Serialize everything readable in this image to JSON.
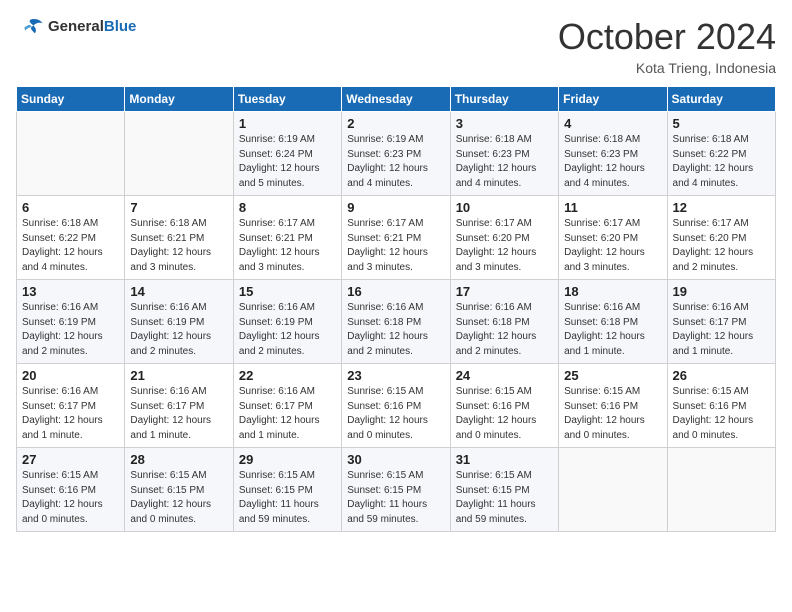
{
  "header": {
    "logo_general": "General",
    "logo_blue": "Blue",
    "title": "October 2024",
    "location": "Kota Trieng, Indonesia"
  },
  "weekdays": [
    "Sunday",
    "Monday",
    "Tuesday",
    "Wednesday",
    "Thursday",
    "Friday",
    "Saturday"
  ],
  "weeks": [
    [
      {
        "day": "",
        "info": ""
      },
      {
        "day": "",
        "info": ""
      },
      {
        "day": "1",
        "info": "Sunrise: 6:19 AM\nSunset: 6:24 PM\nDaylight: 12 hours and 5 minutes."
      },
      {
        "day": "2",
        "info": "Sunrise: 6:19 AM\nSunset: 6:23 PM\nDaylight: 12 hours and 4 minutes."
      },
      {
        "day": "3",
        "info": "Sunrise: 6:18 AM\nSunset: 6:23 PM\nDaylight: 12 hours and 4 minutes."
      },
      {
        "day": "4",
        "info": "Sunrise: 6:18 AM\nSunset: 6:23 PM\nDaylight: 12 hours and 4 minutes."
      },
      {
        "day": "5",
        "info": "Sunrise: 6:18 AM\nSunset: 6:22 PM\nDaylight: 12 hours and 4 minutes."
      }
    ],
    [
      {
        "day": "6",
        "info": "Sunrise: 6:18 AM\nSunset: 6:22 PM\nDaylight: 12 hours and 4 minutes."
      },
      {
        "day": "7",
        "info": "Sunrise: 6:18 AM\nSunset: 6:21 PM\nDaylight: 12 hours and 3 minutes."
      },
      {
        "day": "8",
        "info": "Sunrise: 6:17 AM\nSunset: 6:21 PM\nDaylight: 12 hours and 3 minutes."
      },
      {
        "day": "9",
        "info": "Sunrise: 6:17 AM\nSunset: 6:21 PM\nDaylight: 12 hours and 3 minutes."
      },
      {
        "day": "10",
        "info": "Sunrise: 6:17 AM\nSunset: 6:20 PM\nDaylight: 12 hours and 3 minutes."
      },
      {
        "day": "11",
        "info": "Sunrise: 6:17 AM\nSunset: 6:20 PM\nDaylight: 12 hours and 3 minutes."
      },
      {
        "day": "12",
        "info": "Sunrise: 6:17 AM\nSunset: 6:20 PM\nDaylight: 12 hours and 2 minutes."
      }
    ],
    [
      {
        "day": "13",
        "info": "Sunrise: 6:16 AM\nSunset: 6:19 PM\nDaylight: 12 hours and 2 minutes."
      },
      {
        "day": "14",
        "info": "Sunrise: 6:16 AM\nSunset: 6:19 PM\nDaylight: 12 hours and 2 minutes."
      },
      {
        "day": "15",
        "info": "Sunrise: 6:16 AM\nSunset: 6:19 PM\nDaylight: 12 hours and 2 minutes."
      },
      {
        "day": "16",
        "info": "Sunrise: 6:16 AM\nSunset: 6:18 PM\nDaylight: 12 hours and 2 minutes."
      },
      {
        "day": "17",
        "info": "Sunrise: 6:16 AM\nSunset: 6:18 PM\nDaylight: 12 hours and 2 minutes."
      },
      {
        "day": "18",
        "info": "Sunrise: 6:16 AM\nSunset: 6:18 PM\nDaylight: 12 hours and 1 minute."
      },
      {
        "day": "19",
        "info": "Sunrise: 6:16 AM\nSunset: 6:17 PM\nDaylight: 12 hours and 1 minute."
      }
    ],
    [
      {
        "day": "20",
        "info": "Sunrise: 6:16 AM\nSunset: 6:17 PM\nDaylight: 12 hours and 1 minute."
      },
      {
        "day": "21",
        "info": "Sunrise: 6:16 AM\nSunset: 6:17 PM\nDaylight: 12 hours and 1 minute."
      },
      {
        "day": "22",
        "info": "Sunrise: 6:16 AM\nSunset: 6:17 PM\nDaylight: 12 hours and 1 minute."
      },
      {
        "day": "23",
        "info": "Sunrise: 6:15 AM\nSunset: 6:16 PM\nDaylight: 12 hours and 0 minutes."
      },
      {
        "day": "24",
        "info": "Sunrise: 6:15 AM\nSunset: 6:16 PM\nDaylight: 12 hours and 0 minutes."
      },
      {
        "day": "25",
        "info": "Sunrise: 6:15 AM\nSunset: 6:16 PM\nDaylight: 12 hours and 0 minutes."
      },
      {
        "day": "26",
        "info": "Sunrise: 6:15 AM\nSunset: 6:16 PM\nDaylight: 12 hours and 0 minutes."
      }
    ],
    [
      {
        "day": "27",
        "info": "Sunrise: 6:15 AM\nSunset: 6:16 PM\nDaylight: 12 hours and 0 minutes."
      },
      {
        "day": "28",
        "info": "Sunrise: 6:15 AM\nSunset: 6:15 PM\nDaylight: 12 hours and 0 minutes."
      },
      {
        "day": "29",
        "info": "Sunrise: 6:15 AM\nSunset: 6:15 PM\nDaylight: 11 hours and 59 minutes."
      },
      {
        "day": "30",
        "info": "Sunrise: 6:15 AM\nSunset: 6:15 PM\nDaylight: 11 hours and 59 minutes."
      },
      {
        "day": "31",
        "info": "Sunrise: 6:15 AM\nSunset: 6:15 PM\nDaylight: 11 hours and 59 minutes."
      },
      {
        "day": "",
        "info": ""
      },
      {
        "day": "",
        "info": ""
      }
    ]
  ]
}
